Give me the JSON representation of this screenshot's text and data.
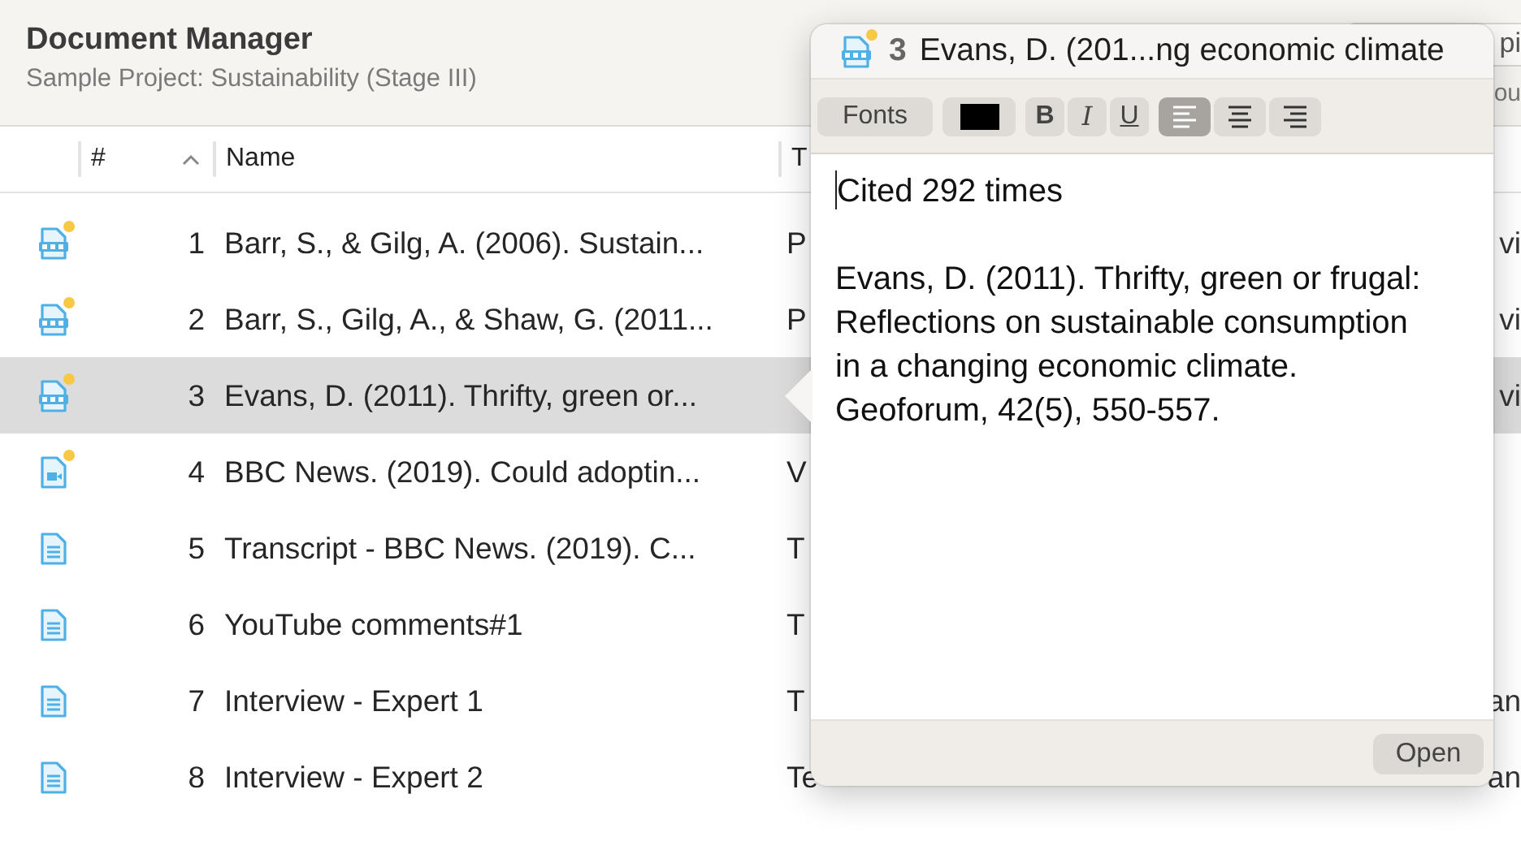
{
  "header": {
    "title": "Document Manager",
    "subtitle": "Sample Project: Sustainability (Stage III)",
    "field_fragment": "pi",
    "label_fragment": "ou"
  },
  "table": {
    "columns": [
      {
        "label": "#",
        "sorted": true
      },
      {
        "label": "Name",
        "sorted": false
      },
      {
        "label": "T",
        "sorted": false
      }
    ],
    "rows": [
      {
        "kind": "pdf",
        "flagged": true,
        "number": "1",
        "name": "Barr, S., & Gilg, A. (2006). Sustain...",
        "type": "P",
        "column_5": "vi",
        "selected": false
      },
      {
        "kind": "pdf",
        "flagged": true,
        "number": "2",
        "name": "Barr, S., Gilg, A., & Shaw, G. (2011...",
        "type": "P",
        "column_5": "vi",
        "selected": false
      },
      {
        "kind": "pdf",
        "flagged": true,
        "number": "3",
        "name": "Evans, D. (2011). Thrifty, green or...",
        "column_5": "vi",
        "selected": true
      },
      {
        "kind": "video",
        "flagged": true,
        "number": "4",
        "name": "BBC News. (2019). Could adoptin...",
        "type": "V",
        "selected": false
      },
      {
        "kind": "text",
        "flagged": false,
        "number": "5",
        "name": "Transcript - BBC News. (2019). C...",
        "type": "T",
        "selected": false
      },
      {
        "kind": "text",
        "flagged": false,
        "number": "6",
        "name": "YouTube comments#1",
        "type": "T",
        "selected": false
      },
      {
        "kind": "text",
        "flagged": false,
        "number": "7",
        "name": "Interview - Expert 1",
        "type": "T",
        "column_5": "an",
        "selected": false
      },
      {
        "kind": "text",
        "flagged": false,
        "number": "8",
        "name": "Interview - Expert 2",
        "type": "Te",
        "column_5": "an",
        "selected": false
      }
    ]
  },
  "popover": {
    "kind": "pdf",
    "flagged": true,
    "number": "3",
    "title": "Evans, D. (201...ng economic climate",
    "toolbar": {
      "fonts": "Fonts",
      "color": "#000000",
      "styles": [
        {
          "label": "B",
          "kind": "bold"
        },
        {
          "label": "I",
          "kind": "italic"
        },
        {
          "label": "U",
          "kind": "underline"
        }
      ],
      "alignments": [
        {
          "kind": "left",
          "selected": true
        },
        {
          "kind": "center",
          "selected": false
        },
        {
          "kind": "right",
          "selected": false
        }
      ]
    },
    "paragraphs": [
      "Cited 292 times",
      "Evans, D. (2011). Thrifty, green or frugal: Reflections on sustainable consumption in a changing economic climate. Geoforum, 42(5), 550-557."
    ],
    "open_button": "Open"
  }
}
